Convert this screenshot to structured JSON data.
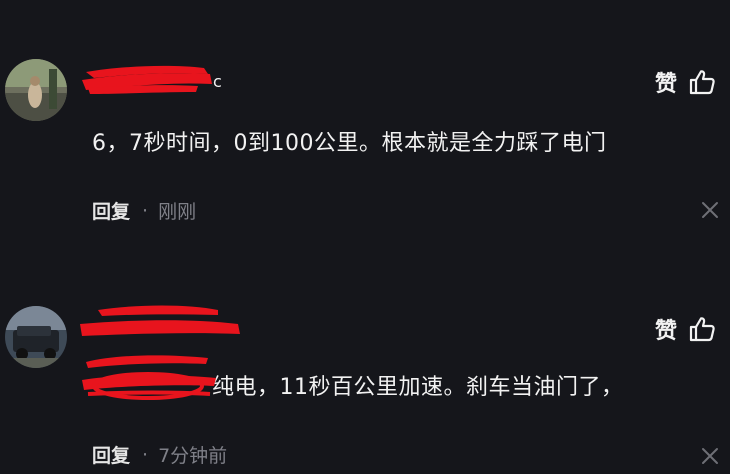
{
  "comments": [
    {
      "like_label": "赞",
      "text": "6，7秒时间，0到100公里。根本就是全力踩了电门",
      "reply_label": "回复",
      "separator": "·",
      "time": "刚刚"
    },
    {
      "like_label": "赞",
      "text": "纯电，11秒百公里加速。刹车当油门了，",
      "reply_label": "回复",
      "separator": "·",
      "time": "7分钟前"
    }
  ],
  "colors": {
    "background": "#15161b",
    "redaction": "#e8141d",
    "muted_text": "#7f8088"
  },
  "icons": {
    "like": "thumbs-up-outline-icon",
    "dismiss": "close-icon"
  }
}
